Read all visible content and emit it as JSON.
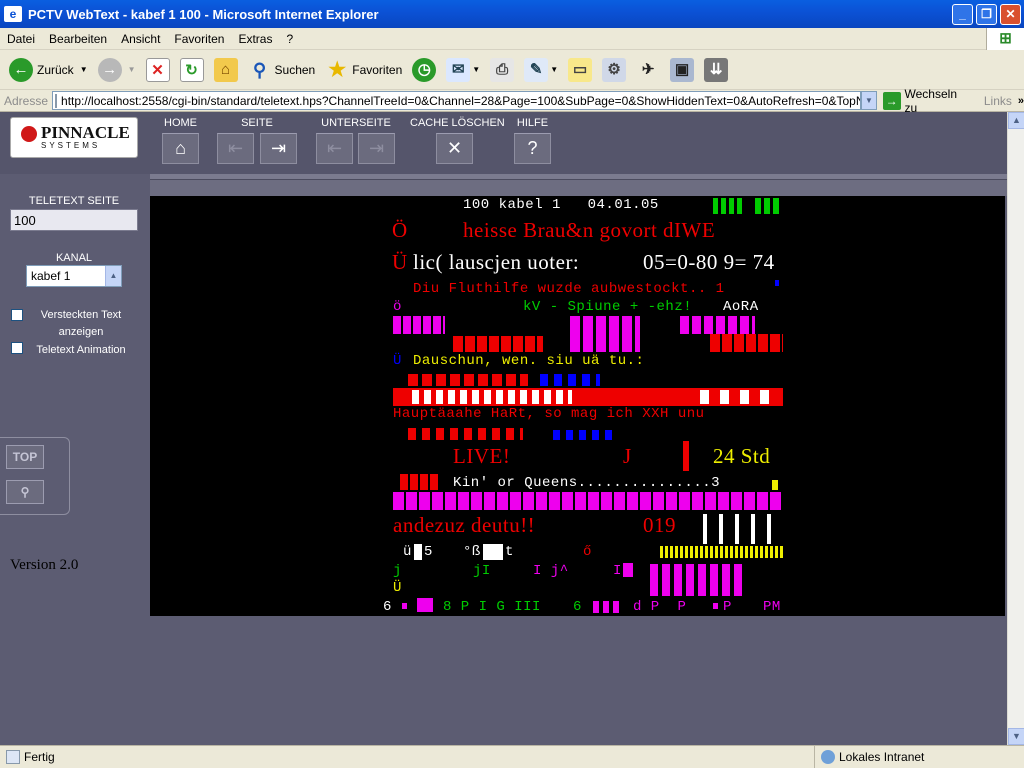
{
  "window": {
    "title": "PCTV WebText - kabef 1 100 - Microsoft Internet Explorer"
  },
  "menu": [
    "Datei",
    "Bearbeiten",
    "Ansicht",
    "Favoriten",
    "Extras",
    "?"
  ],
  "toolbar": {
    "back": "Zurück",
    "search": "Suchen",
    "favorites": "Favoriten"
  },
  "address": {
    "label": "Adresse",
    "url": "http://localhost:2558/cgi-bin/standard/teletext.hps?ChannelTreeId=0&Channel=28&Page=100&SubPage=0&ShowHiddenText=0&AutoRefresh=0&TopNavigation",
    "go": "Wechseln zu",
    "links": "Links"
  },
  "brand": {
    "name": "PINNACLE",
    "sub": "SYSTEMS"
  },
  "nav": {
    "home": "HOME",
    "seite": "SEITE",
    "unterseite": "UNTERSEITE",
    "cache": "CACHE LÖSCHEN",
    "hilfe": "HILFE"
  },
  "sidebar": {
    "page_label": "TELETEXT SEITE",
    "page_value": "100",
    "kanal_label": "KANAL",
    "kanal_value": "kabef 1",
    "hidden_text_l1": "Versteckten Text",
    "hidden_text_l2": "anzeigen",
    "animation": "Teletext Animation",
    "top_button": "TOP",
    "version": "Version 2.0"
  },
  "teletext": {
    "header": "100 kabel 1   04.01.05",
    "r1_a": "Ö",
    "r1_b": "heisse Brau&n govort dIWE",
    "r2_a": "Ü",
    "r2_b": "lic( lauscjen uoter:",
    "r2_c": "05=0-80 9= 74",
    "r3": "Diu Fluthilfe wuzde aubwestockt.. 1",
    "r4_a": "ö",
    "r4_b": "kV - Spiune + -ehz!",
    "r4_c": "AoRA",
    "r5_a": "Ü",
    "r5_b": "Dauschun, wen. siu uä tu.:",
    "r6": "Hauptäaahe HaRt, so mag ich XXH unu",
    "r7_a": "LIVE!",
    "r7_b": "J",
    "r7_c": "24 Std",
    "r8": "Kin' or Queens...............3",
    "r9_a": "andezuz deutu!!",
    "r9_b": "019",
    "r10_a": "ü",
    "r10_b": "5",
    "r10_c": "°ß",
    "r10_d": "t",
    "r10_e": "ő",
    "r11_a": "j",
    "r11_b": "jI",
    "r11_c": "I j^",
    "r11_d": "I",
    "r12": "Ü",
    "foot_a": "6",
    "foot_b": "8 P I G III",
    "foot_c": "6",
    "foot_d": "d P  P",
    "foot_e": "P",
    "foot_f": "PM"
  },
  "status": {
    "left": "Fertig",
    "zone": "Lokales Intranet"
  }
}
